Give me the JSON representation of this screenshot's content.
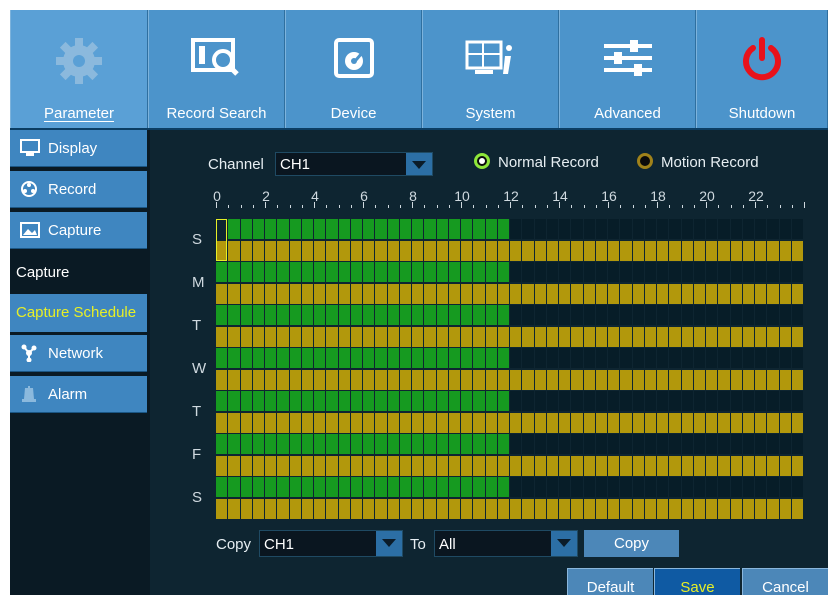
{
  "toolbar": {
    "items": [
      {
        "label": "Parameter",
        "icon": "gear-icon"
      },
      {
        "label": "Record Search",
        "icon": "record-search-icon"
      },
      {
        "label": "Device",
        "icon": "device-icon"
      },
      {
        "label": "System",
        "icon": "system-icon"
      },
      {
        "label": "Advanced",
        "icon": "advanced-icon"
      },
      {
        "label": "Shutdown",
        "icon": "power-icon"
      }
    ]
  },
  "sidebar": {
    "items": [
      {
        "label": "Display",
        "icon": "monitor-icon"
      },
      {
        "label": "Record",
        "icon": "record-icon"
      },
      {
        "label": "Capture",
        "icon": "capture-icon"
      }
    ],
    "subitems": [
      {
        "label": "Capture"
      },
      {
        "label": "Capture Schedule"
      }
    ],
    "bottom_items": [
      {
        "label": "Network",
        "icon": "network-icon"
      },
      {
        "label": "Alarm",
        "icon": "alarm-icon"
      }
    ]
  },
  "schedule": {
    "channel_label": "Channel",
    "channel_value": "CH1",
    "legend": [
      {
        "label": "Normal Record",
        "color": "#8ee63a",
        "selected": true
      },
      {
        "label": "Motion Record",
        "color": "#a0821a",
        "selected": false
      }
    ],
    "hour_labels": [
      "0",
      "2",
      "4",
      "6",
      "8",
      "10",
      "12",
      "14",
      "16",
      "18",
      "20",
      "22"
    ],
    "days": [
      "S",
      "M",
      "T",
      "W",
      "T",
      "F",
      "S"
    ],
    "normal_hours": [
      0,
      12
    ],
    "motion_hours": [
      0,
      24
    ],
    "colors": {
      "normal": "#169a20",
      "motion": "#b2980c",
      "empty": "#071d28"
    }
  },
  "copy": {
    "copy_label": "Copy",
    "from_value": "CH1",
    "to_label": "To",
    "to_value": "All",
    "button_label": "Copy"
  },
  "buttons": {
    "default": "Default",
    "save": "Save",
    "cancel": "Cancel"
  }
}
